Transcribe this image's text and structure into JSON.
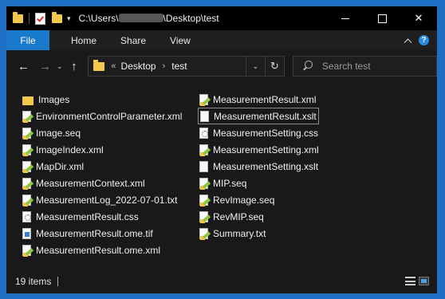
{
  "titlebar": {
    "path_prefix": "C:\\Users\\",
    "path_suffix": "\\Desktop\\test",
    "minimize_glyph": "",
    "maximize_glyph": "",
    "close_glyph": "✕"
  },
  "ribbon": {
    "tabs": [
      "File",
      "Home",
      "Share",
      "View"
    ]
  },
  "nav": {
    "back_icon": "←",
    "forward_icon": "→",
    "recent_icon": "⌄",
    "up_icon": "↑",
    "breadcrumb_overflow": "«",
    "breadcrumb": [
      "Desktop",
      "test"
    ],
    "breadcrumb_sep": "›",
    "address_dropdown_icon": "⌄",
    "refresh_icon": "↻",
    "search_placeholder": "Search test"
  },
  "files": {
    "column1": [
      {
        "name": "Images",
        "icon": "folder-icon"
      },
      {
        "name": "EnvironmentControlParameter.xml",
        "icon": "xml-file-icon"
      },
      {
        "name": "Image.seq",
        "icon": "xml-file-icon"
      },
      {
        "name": "ImageIndex.xml",
        "icon": "xml-file-icon"
      },
      {
        "name": "MapDir.xml",
        "icon": "xml-file-icon"
      },
      {
        "name": "MeasurementContext.xml",
        "icon": "xml-file-icon"
      },
      {
        "name": "MeasurementLog_2022-07-01.txt",
        "icon": "xml-file-icon"
      },
      {
        "name": "MeasurementResult.css",
        "icon": "css-file-icon"
      },
      {
        "name": "MeasurementResult.ome.tif",
        "icon": "image-file-icon"
      },
      {
        "name": "MeasurementResult.ome.xml",
        "icon": "xml-file-icon"
      }
    ],
    "column2": [
      {
        "name": "MeasurementResult.xml",
        "icon": "xml-file-icon"
      },
      {
        "name": "MeasurementResult.xslt",
        "icon": "blank-file-icon",
        "selected": true
      },
      {
        "name": "MeasurementSetting.css",
        "icon": "css-file-icon"
      },
      {
        "name": "MeasurementSetting.xml",
        "icon": "xml-file-icon"
      },
      {
        "name": "MeasurementSetting.xslt",
        "icon": "blank-file-icon"
      },
      {
        "name": "MIP.seq",
        "icon": "xml-file-icon"
      },
      {
        "name": "RevImage.seq",
        "icon": "xml-file-icon"
      },
      {
        "name": "RevMIP.seq",
        "icon": "xml-file-icon"
      },
      {
        "name": "Summary.txt",
        "icon": "xml-file-icon"
      }
    ]
  },
  "status": {
    "item_count": "19 items"
  },
  "colors": {
    "accent": "#1979ca",
    "background": "#191919",
    "folder": "#f2c94c"
  }
}
